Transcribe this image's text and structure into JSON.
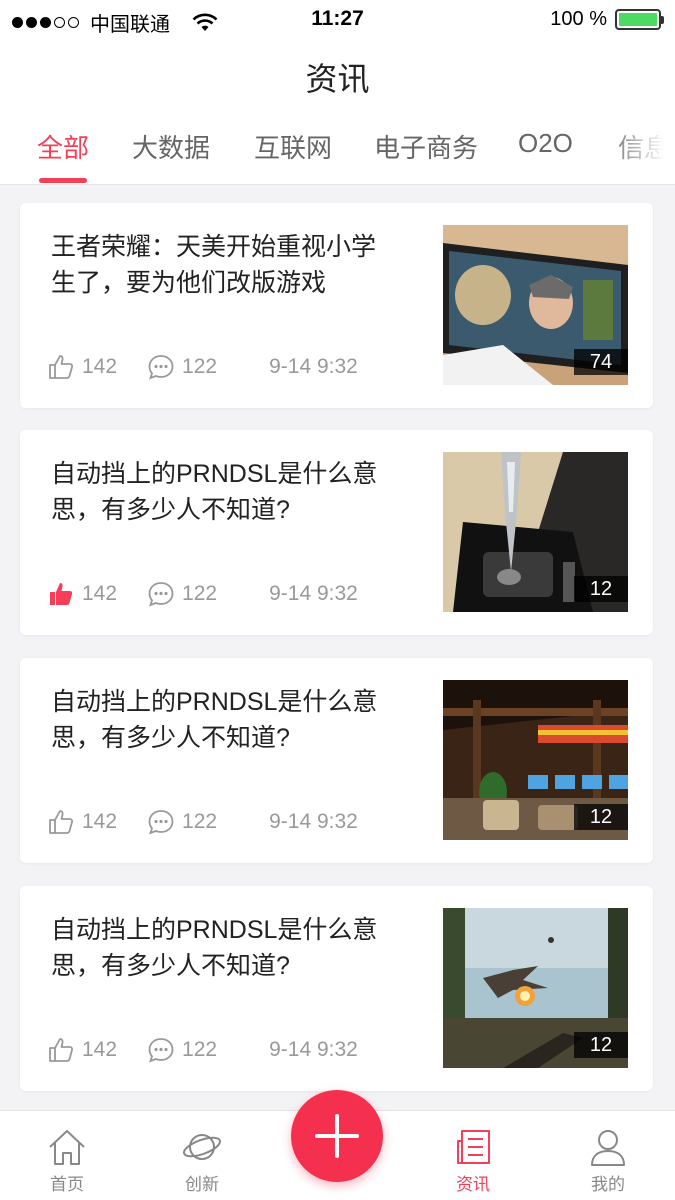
{
  "status_bar": {
    "carrier": "中国联通",
    "time": "11:27",
    "battery": "100 %",
    "signal_bars": 3
  },
  "header": {
    "title": "资讯"
  },
  "tabs": [
    {
      "label": "全部",
      "active": true
    },
    {
      "label": "大数据",
      "active": false
    },
    {
      "label": "互联网",
      "active": false
    },
    {
      "label": "电子商务",
      "active": false
    },
    {
      "label": "O2O",
      "active": false
    },
    {
      "label": "信息",
      "active": false
    }
  ],
  "articles": [
    {
      "title": "王者荣耀：天美开始重视小学生了，要为他们改版游戏",
      "likes": "142",
      "liked": false,
      "comments": "122",
      "date": "9-14 9:32",
      "image_count": "74"
    },
    {
      "title": "自动挡上的PRNDSL是什么意思，有多少人不知道?",
      "likes": "142",
      "liked": true,
      "comments": "122",
      "date": "9-14 9:32",
      "image_count": "12"
    },
    {
      "title": "自动挡上的PRNDSL是什么意思，有多少人不知道?",
      "likes": "142",
      "liked": false,
      "comments": "122",
      "date": "9-14 9:32",
      "image_count": "12"
    },
    {
      "title": "自动挡上的PRNDSL是什么意思，有多少人不知道?",
      "likes": "142",
      "liked": false,
      "comments": "122",
      "date": "9-14 9:32",
      "image_count": "12"
    }
  ],
  "bottom_nav": [
    {
      "label": "首页",
      "icon": "home-icon",
      "active": false
    },
    {
      "label": "创新",
      "icon": "planet-icon",
      "active": false
    },
    {
      "label": "资讯",
      "icon": "news-icon",
      "active": true
    },
    {
      "label": "我的",
      "icon": "user-icon",
      "active": false
    }
  ],
  "fab": {
    "icon": "plus-icon"
  },
  "colors": {
    "accent": "#f53f58",
    "background": "#f3f3f6",
    "battery": "#4cd964"
  }
}
